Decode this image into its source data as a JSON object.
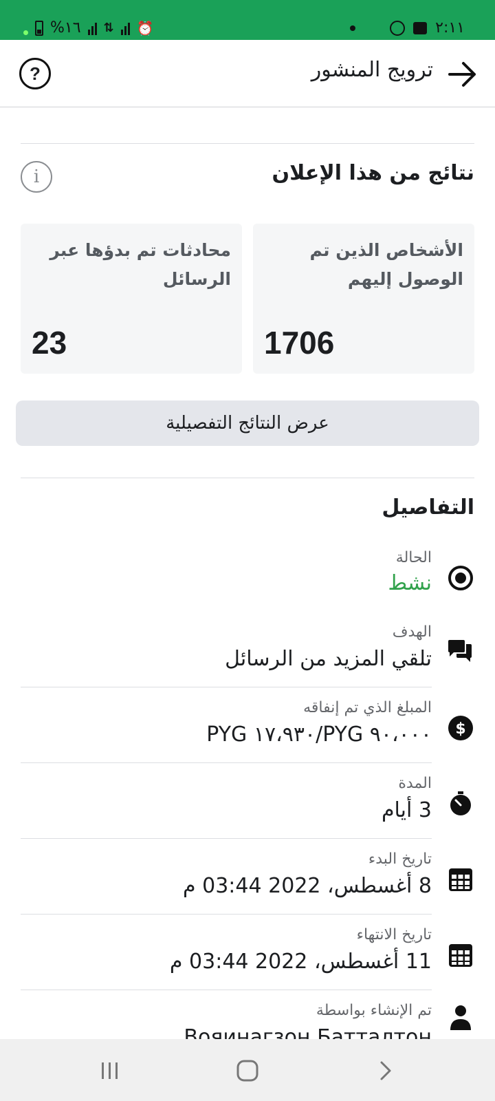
{
  "status_bar": {
    "time": "٢:١١",
    "battery": "%١٦"
  },
  "header": {
    "title": "ترويج المنشور",
    "help": "?"
  },
  "results": {
    "title": "نتائج من هذا الإعلان",
    "info": "i",
    "metrics": [
      {
        "label": "الأشخاص الذين تم الوصول إليهم",
        "value": "1706"
      },
      {
        "label": "محادثات تم بدؤها عبر الرسائل",
        "value": "23"
      }
    ],
    "button_label": "عرض النتائج التفصيلية"
  },
  "details": {
    "title": "التفاصيل",
    "items": [
      {
        "icon": "target-icon",
        "label": "الحالة",
        "value": "نشط"
      },
      {
        "icon": "chat-bubbles-icon",
        "label": "الهدف",
        "value": "تلقي المزيد من الرسائل"
      },
      {
        "icon": "dollar-icon",
        "label": "المبلغ الذي تم إنفاقه",
        "value": "PYG ١٧،٩٣٠/PYG ٩٠،٠٠٠"
      },
      {
        "icon": "stopwatch-icon",
        "label": "المدة",
        "value": "3 أيام"
      },
      {
        "icon": "calendar-icon",
        "label": "تاريخ البدء",
        "value": "8 أغسطس، 2022 03:44 م"
      },
      {
        "icon": "calendar-icon",
        "label": "تاريخ الانتهاء",
        "value": "11 أغسطس، 2022 03:44 م"
      },
      {
        "icon": "person-icon",
        "label": "تم الإنشاء بواسطة",
        "value": "Boяинагзон Батталтон"
      }
    ]
  },
  "colors": {
    "status_bar": "#1aa158",
    "active_status": "#31a24c",
    "button_bg": "#e4e6eb"
  }
}
